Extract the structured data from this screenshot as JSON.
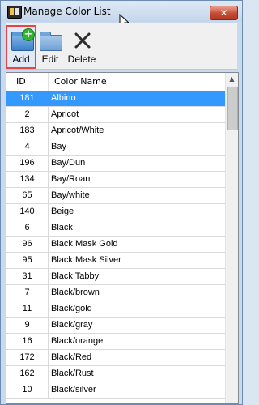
{
  "window": {
    "title": "Manage Color List",
    "close_label": "✕"
  },
  "toolbar": {
    "add_label": "Add",
    "edit_label": "Edit",
    "delete_label": "Delete"
  },
  "grid": {
    "columns": [
      "ID",
      "Color Name"
    ],
    "rows": [
      {
        "id": "181",
        "name": "Albino"
      },
      {
        "id": "2",
        "name": "Apricot"
      },
      {
        "id": "183",
        "name": "Apricot/White"
      },
      {
        "id": "4",
        "name": "Bay"
      },
      {
        "id": "196",
        "name": "Bay/Dun"
      },
      {
        "id": "134",
        "name": "Bay/Roan"
      },
      {
        "id": "65",
        "name": "Bay/white"
      },
      {
        "id": "140",
        "name": "Beige"
      },
      {
        "id": "6",
        "name": "Black"
      },
      {
        "id": "96",
        "name": "Black Mask Gold"
      },
      {
        "id": "95",
        "name": "Black Mask Silver"
      },
      {
        "id": "31",
        "name": "Black Tabby"
      },
      {
        "id": "7",
        "name": "Black/brown"
      },
      {
        "id": "11",
        "name": "Black/gold"
      },
      {
        "id": "9",
        "name": "Black/gray"
      },
      {
        "id": "16",
        "name": "Black/orange"
      },
      {
        "id": "172",
        "name": "Black/Red"
      },
      {
        "id": "162",
        "name": "Black/Rust"
      },
      {
        "id": "10",
        "name": "Black/silver"
      }
    ]
  },
  "icons": {
    "app": "app-icon",
    "add": "add-folder-icon",
    "edit": "folder-icon",
    "delete": "x-icon"
  },
  "colors": {
    "selection": "#3399ff",
    "highlight_border": "#e64545"
  }
}
